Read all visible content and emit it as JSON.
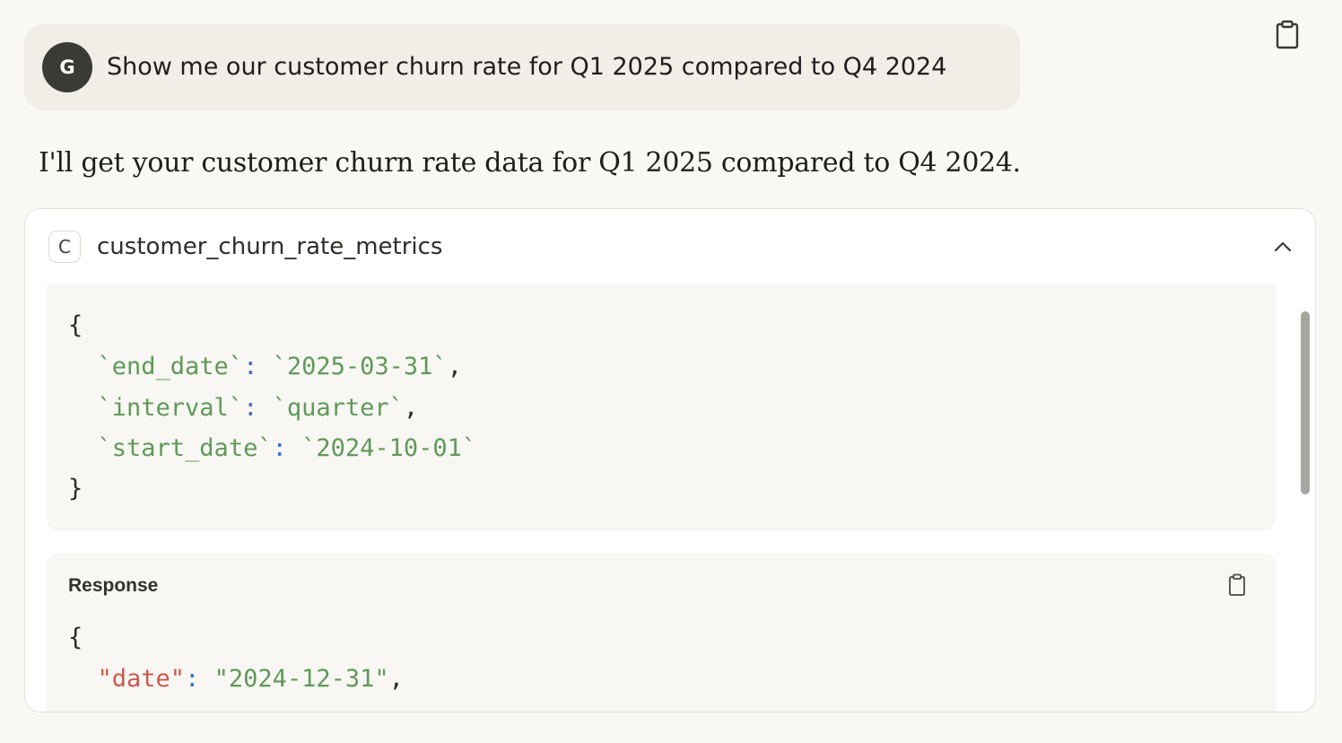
{
  "user_message": {
    "avatar_initial": "G",
    "text": "Show me our customer churn rate for Q1 2025 compared to Q4 2024"
  },
  "assistant_message": {
    "text": "I'll get your customer churn rate data for Q1 2025 compared to Q4 2024."
  },
  "tool_call": {
    "badge": "C",
    "name": "customer_churn_rate_metrics",
    "request": {
      "open_brace": "{",
      "close_brace": "}",
      "params": [
        {
          "key": "`end_date`",
          "colon": ":",
          "value": "`2025-03-31`",
          "trail": ","
        },
        {
          "key": "`interval`",
          "colon": ":",
          "value": "`quarter`",
          "trail": ","
        },
        {
          "key": "`start_date`",
          "colon": ":",
          "value": "`2024-10-01`",
          "trail": ""
        }
      ]
    },
    "response": {
      "title": "Response",
      "open_brace": "{",
      "lines": [
        {
          "key": "\"date\"",
          "colon": ":",
          "value": "\"2024-12-31\"",
          "trail": ","
        }
      ]
    }
  },
  "icons": {
    "top_copy": "clipboard-icon",
    "collapse": "chevron-up-icon",
    "response_copy": "clipboard-icon"
  },
  "colors": {
    "string_green": "#5f9a57",
    "colon_blue": "#3f6ec9",
    "key_red": "#cc5a4e",
    "user_bubble": "#f0eee7",
    "avatar_bg": "#3b3b36"
  }
}
